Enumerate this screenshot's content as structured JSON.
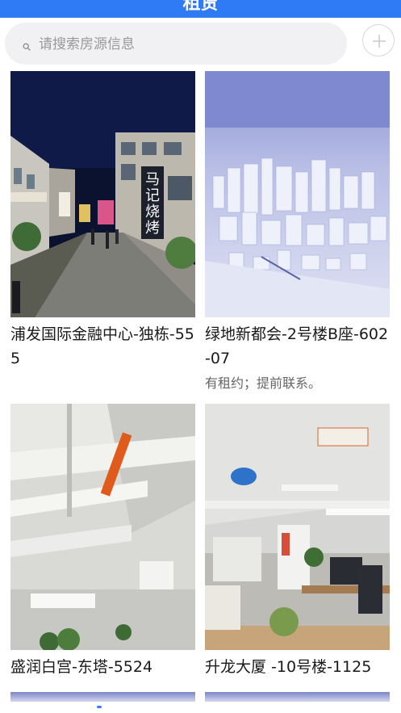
{
  "header": {
    "title": "租赁"
  },
  "search": {
    "placeholder": "请搜索房源信息",
    "value": ""
  },
  "icons": {
    "search": "search-icon",
    "add": "plus-icon"
  },
  "colors": {
    "header_blue": "#2f7bf6",
    "search_bg": "#f1f1f3",
    "title_text": "#1a1a1a",
    "note_text": "#666666"
  },
  "listings": [
    {
      "title": "浦发国际金融中心-独栋-555",
      "note": "",
      "image": "night street with shops"
    },
    {
      "title": "绿地新都会-2号楼B座-602-07",
      "note": "有租约；提前联系。",
      "image": "3D city model render"
    },
    {
      "title": "盛润白宫-东塔-5524",
      "note": "",
      "image": "office interior ceiling"
    },
    {
      "title": "升龙大厦 -10号楼-1125",
      "note": "",
      "image": "open office workspace"
    }
  ]
}
